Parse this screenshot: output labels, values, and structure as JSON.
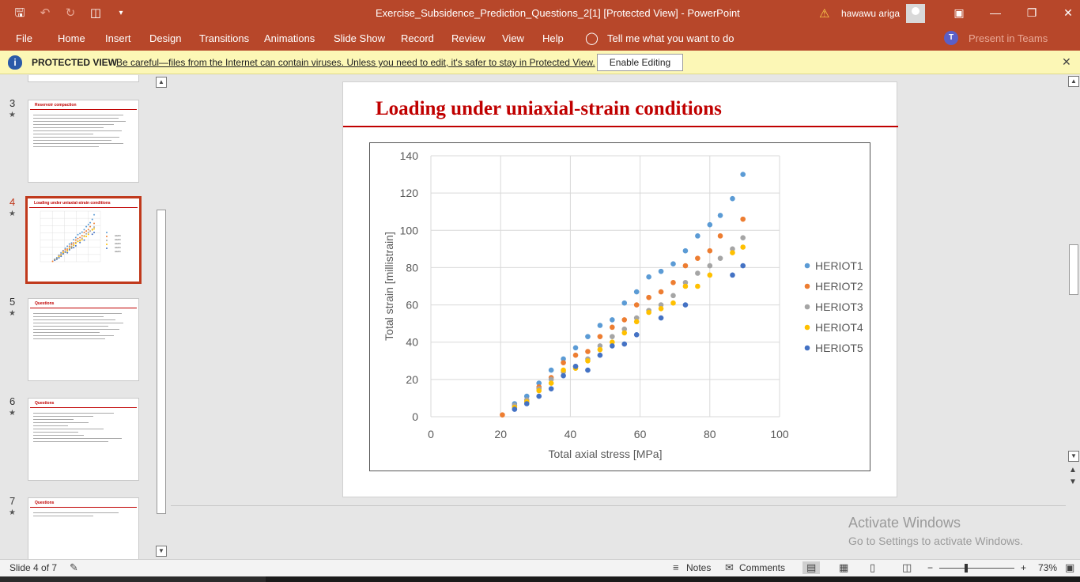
{
  "window": {
    "doc_title": "Exercise_Subsidence_Prediction_Questions_2[1] [Protected View]  -  PowerPoint",
    "user": "hawawu ariga",
    "buttons": [
      "ribbon-display-icon",
      "minimize-icon",
      "restore-icon",
      "close-icon"
    ]
  },
  "quick_access": [
    "save-icon",
    "undo-icon",
    "redo-icon",
    "present-from-start-icon",
    "customize-icon"
  ],
  "menu": {
    "items": [
      "File",
      "Home",
      "Insert",
      "Design",
      "Transitions",
      "Animations",
      "Slide Show",
      "Record",
      "Review",
      "View",
      "Help"
    ],
    "tell_me": "Tell me what you want to do",
    "present_in_teams": "Present in Teams"
  },
  "protected_view": {
    "label": "PROTECTED VIEW",
    "message": "Be careful—files from the Internet can contain viruses. Unless you need to edit, it's safer to stay in Protected View.",
    "enable_button": "Enable Editing"
  },
  "thumbnails": [
    {
      "num": "3",
      "title": "Reservoir compaction"
    },
    {
      "num": "4",
      "title": "Loading under uniaxial-strain conditions",
      "selected": true
    },
    {
      "num": "5",
      "title": "Questions"
    },
    {
      "num": "6",
      "title": "Questions"
    },
    {
      "num": "7",
      "title": "Questions"
    }
  ],
  "slide": {
    "title": "Loading under uniaxial-strain conditions"
  },
  "chart_data": {
    "type": "scatter",
    "title": "",
    "xlabel": "Total axial stress [MPa]",
    "ylabel": "Total strain [millistrain]",
    "xlim": [
      0,
      100
    ],
    "ylim": [
      0,
      140
    ],
    "xticks": [
      0,
      20,
      40,
      60,
      80,
      100
    ],
    "yticks": [
      0,
      20,
      40,
      60,
      80,
      100,
      120,
      140
    ],
    "grid": true,
    "legend": "right",
    "series": [
      {
        "name": "HERIOT1",
        "color": "#5b9bd5",
        "points": [
          [
            24,
            7
          ],
          [
            27.5,
            11
          ],
          [
            31,
            18
          ],
          [
            34.5,
            25
          ],
          [
            38,
            31
          ],
          [
            41.5,
            37
          ],
          [
            45,
            43
          ],
          [
            48.5,
            49
          ],
          [
            52,
            52
          ],
          [
            55.5,
            61
          ],
          [
            59,
            67
          ],
          [
            62.5,
            75
          ],
          [
            66,
            78
          ],
          [
            69.5,
            82
          ],
          [
            73,
            89
          ],
          [
            76.5,
            97
          ],
          [
            80,
            103
          ],
          [
            83,
            108
          ],
          [
            86.5,
            117
          ],
          [
            89.5,
            130
          ]
        ]
      },
      {
        "name": "HERIOT2",
        "color": "#ed7d31",
        "points": [
          [
            20.5,
            1
          ],
          [
            24,
            6
          ],
          [
            27.5,
            9
          ],
          [
            31,
            16
          ],
          [
            34.5,
            21
          ],
          [
            38,
            29
          ],
          [
            41.5,
            33
          ],
          [
            45,
            35
          ],
          [
            48.5,
            43
          ],
          [
            52,
            48
          ],
          [
            55.5,
            52
          ],
          [
            59,
            60
          ],
          [
            62.5,
            64
          ],
          [
            66,
            67
          ],
          [
            69.5,
            72
          ],
          [
            73,
            81
          ],
          [
            76.5,
            85
          ],
          [
            80,
            89
          ],
          [
            83,
            97
          ],
          [
            89.5,
            106
          ]
        ]
      },
      {
        "name": "HERIOT3",
        "color": "#a5a5a5",
        "points": [
          [
            24,
            6
          ],
          [
            27.5,
            9
          ],
          [
            31,
            15
          ],
          [
            34.5,
            20
          ],
          [
            38,
            24
          ],
          [
            41.5,
            27
          ],
          [
            45,
            31
          ],
          [
            48.5,
            38
          ],
          [
            52,
            43
          ],
          [
            55.5,
            47
          ],
          [
            59,
            53
          ],
          [
            62.5,
            57
          ],
          [
            66,
            60
          ],
          [
            69.5,
            65
          ],
          [
            73,
            72
          ],
          [
            76.5,
            77
          ],
          [
            80,
            81
          ],
          [
            83,
            85
          ],
          [
            86.5,
            90
          ],
          [
            89.5,
            96
          ]
        ]
      },
      {
        "name": "HERIOT4",
        "color": "#ffc000",
        "points": [
          [
            24,
            5
          ],
          [
            27.5,
            8
          ],
          [
            31,
            14
          ],
          [
            34.5,
            18
          ],
          [
            38,
            25
          ],
          [
            41.5,
            26
          ],
          [
            45,
            30
          ],
          [
            48.5,
            36
          ],
          [
            52,
            40
          ],
          [
            55.5,
            45
          ],
          [
            59,
            51
          ],
          [
            62.5,
            56
          ],
          [
            66,
            58
          ],
          [
            69.5,
            61
          ],
          [
            73,
            70
          ],
          [
            76.5,
            70
          ],
          [
            80,
            76
          ],
          [
            86.5,
            88
          ],
          [
            89.5,
            91
          ]
        ]
      },
      {
        "name": "HERIOT5",
        "color": "#4472c4",
        "points": [
          [
            24,
            4
          ],
          [
            27.5,
            7
          ],
          [
            31,
            11
          ],
          [
            34.5,
            15
          ],
          [
            38,
            22
          ],
          [
            41.5,
            27
          ],
          [
            45,
            25
          ],
          [
            48.5,
            33
          ],
          [
            52,
            38
          ],
          [
            55.5,
            39
          ],
          [
            59,
            44
          ],
          [
            66,
            53
          ],
          [
            73,
            60
          ],
          [
            86.5,
            76
          ],
          [
            89.5,
            81
          ]
        ]
      }
    ]
  },
  "watermark": {
    "line1": "Activate Windows",
    "line2": "Go to Settings to activate Windows."
  },
  "status": {
    "slide": "Slide 4 of 7",
    "notes": "Notes",
    "comments": "Comments",
    "zoom": "73%"
  }
}
